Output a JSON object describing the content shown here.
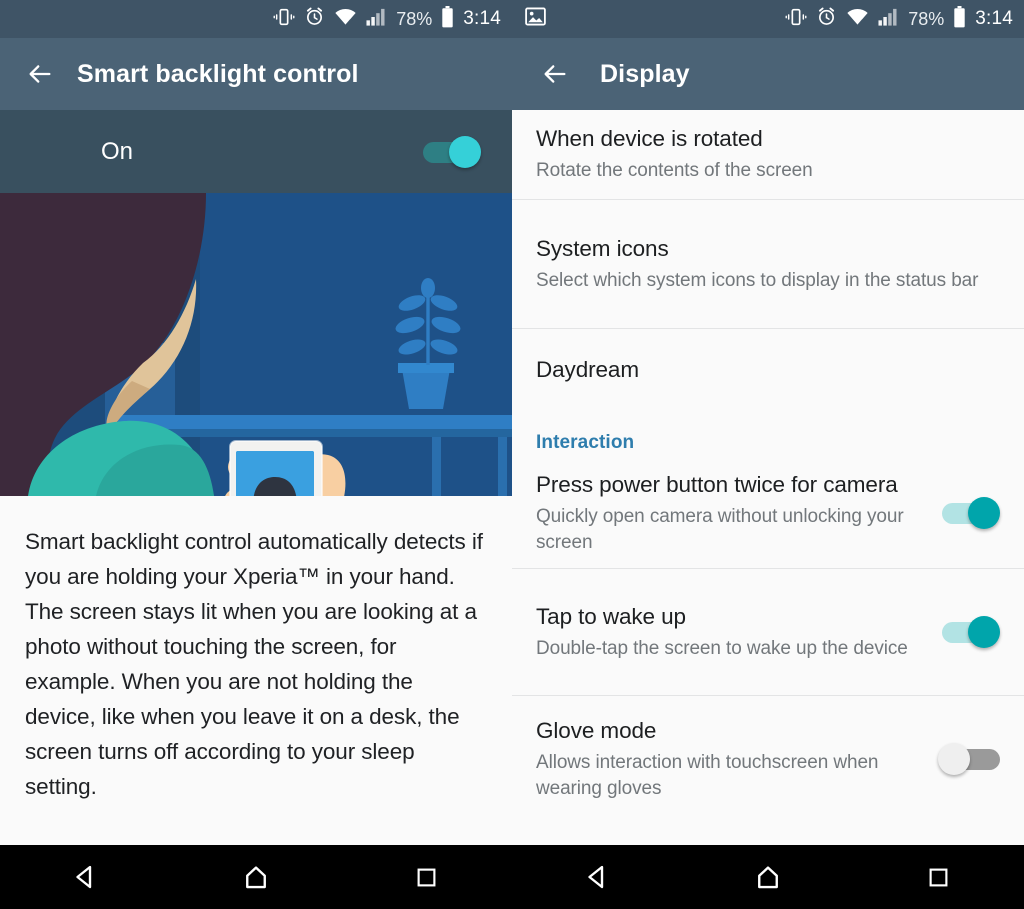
{
  "status_bar": {
    "icons": [
      "vibrate-icon",
      "alarm-icon",
      "wifi-icon",
      "signal-icon"
    ],
    "battery_percent": "78%",
    "time": "3:14",
    "right_panel_notification_icon": "image-icon",
    "background_color": "#3f5466"
  },
  "left_panel": {
    "appbar": {
      "back_icon": "back-arrow-icon",
      "title": "Smart backlight control",
      "background_color": "#4b6376"
    },
    "master_switch": {
      "label": "On",
      "state": "on",
      "accent_color": "#35d0d8"
    },
    "illustration": {
      "alt": "Person holding a phone showing a photo, with a plant on a table",
      "background_color": "#1e4b7a"
    },
    "description": "Smart backlight control automatically detects if you are holding your Xperia™ in your hand. The screen stays lit when you are looking at a photo without touching the screen, for example. When you are not holding the device, like when you leave it on a desk, the screen turns off according to your sleep setting."
  },
  "right_panel": {
    "appbar": {
      "back_icon": "back-arrow-icon",
      "title": "Display",
      "background_color": "#4b6376"
    },
    "items": [
      {
        "title": "When device is rotated",
        "subtitle": "Rotate the contents of the screen",
        "toggle": null
      },
      {
        "title": "System icons",
        "subtitle": "Select which system icons to display in the status bar",
        "toggle": null
      },
      {
        "title": "Daydream",
        "subtitle": "",
        "toggle": null
      }
    ],
    "section": {
      "label": "Interaction",
      "color": "#2e7dad"
    },
    "interaction_items": [
      {
        "title": "Press power button twice for camera",
        "subtitle": "Quickly open camera without unlocking your screen",
        "toggle": "on"
      },
      {
        "title": "Tap to wake up",
        "subtitle": "Double-tap the screen to wake up the device",
        "toggle": "on"
      },
      {
        "title": "Glove mode",
        "subtitle": "Allows interaction with touchscreen when wearing gloves",
        "toggle": "off"
      }
    ]
  },
  "nav_bar": {
    "back_label": "back-nav-icon",
    "home_label": "home-nav-icon",
    "recents_label": "recents-nav-icon",
    "background_color": "#000000"
  }
}
